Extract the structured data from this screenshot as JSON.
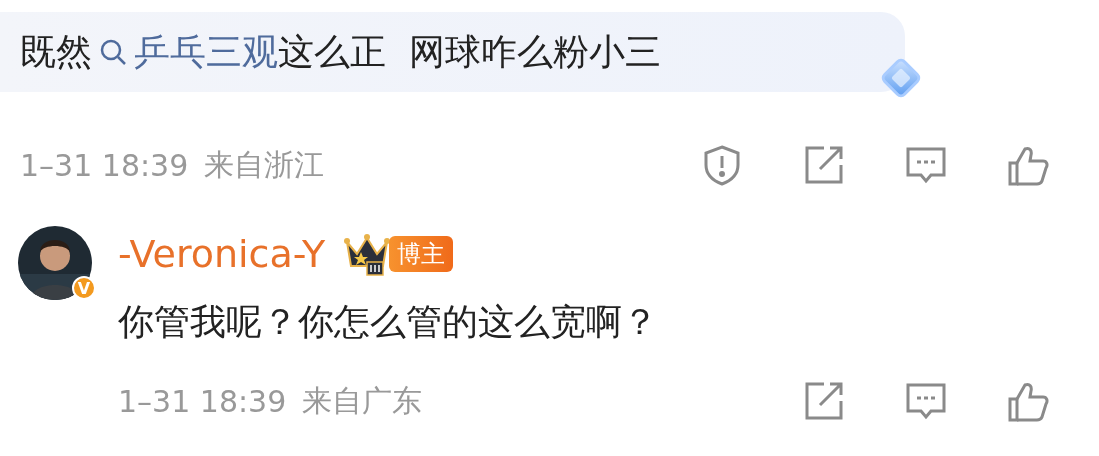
{
  "comment": {
    "text_before": "既然",
    "topic": "乒乓三观",
    "text_after": "这么正  网球咋么粉小三",
    "time": "1–31 18:39",
    "location": "来自浙江",
    "actions": [
      {
        "kind": "report"
      },
      {
        "kind": "repost"
      },
      {
        "kind": "comment"
      },
      {
        "kind": "like"
      }
    ]
  },
  "reply": {
    "username": "-Veronica-Y",
    "verified_badge": "V",
    "badge": "博主",
    "text": "你管我呢？你怎么管的这么宽啊？",
    "time": "1–31 18:39",
    "location": "来自广东",
    "actions": [
      {
        "kind": "repost"
      },
      {
        "kind": "comment"
      },
      {
        "kind": "like"
      }
    ]
  }
}
